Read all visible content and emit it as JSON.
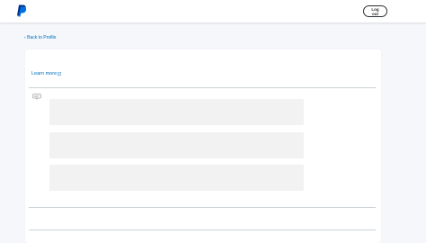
{
  "header": {
    "logo_icon": "paypal-logo",
    "logout_label": "Log out"
  },
  "nav": {
    "back_label": "Back to Profile",
    "back_icon": "chevron-left-icon"
  },
  "card": {
    "learn_more_label": "Learn more",
    "learn_more_icon": "external-link-icon",
    "info_icon": "tooltip-icon",
    "skeleton_rows": 3
  },
  "colors": {
    "link": "#0070ba",
    "background": "#f5f7fa",
    "skeleton": "#f2f2f2",
    "divider": "#cbd2d6"
  }
}
